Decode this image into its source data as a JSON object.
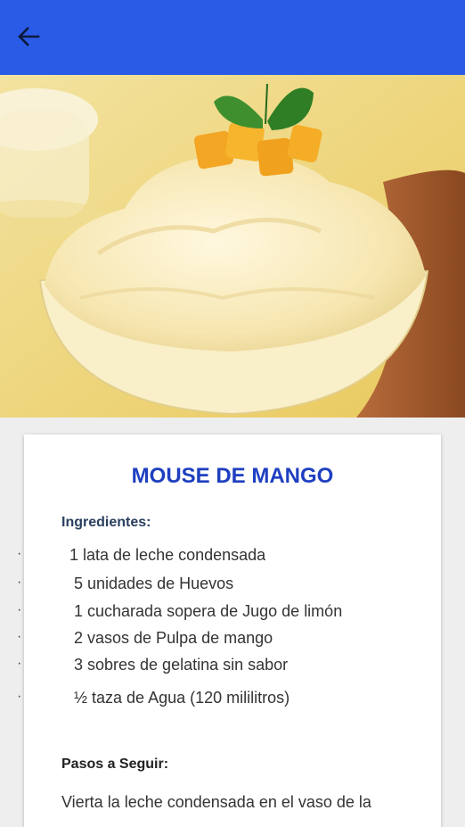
{
  "app_bar": {
    "back_icon": "arrow-back-icon",
    "color": "#2a5be6"
  },
  "hero": {
    "alt": "mango mousse dessert photo"
  },
  "recipe": {
    "title": "MOUSE DE MANGO",
    "ingredients_label": "Ingredientes:",
    "ingredients": [
      "1 lata de leche condensada",
      "5 unidades de Huevos",
      "1 cucharada sopera de Jugo de limón",
      "2 vasos de Pulpa de mango",
      "3 sobres de gelatina sin sabor",
      "½ taza de Agua (120 mililitros)"
    ],
    "bullet": "·",
    "steps_label": "Pasos a Seguir:",
    "steps_first_line": "Vierta la leche condensada en el vaso de la"
  },
  "colors": {
    "title": "#1e3fc0",
    "label": "#2a3f5f"
  }
}
